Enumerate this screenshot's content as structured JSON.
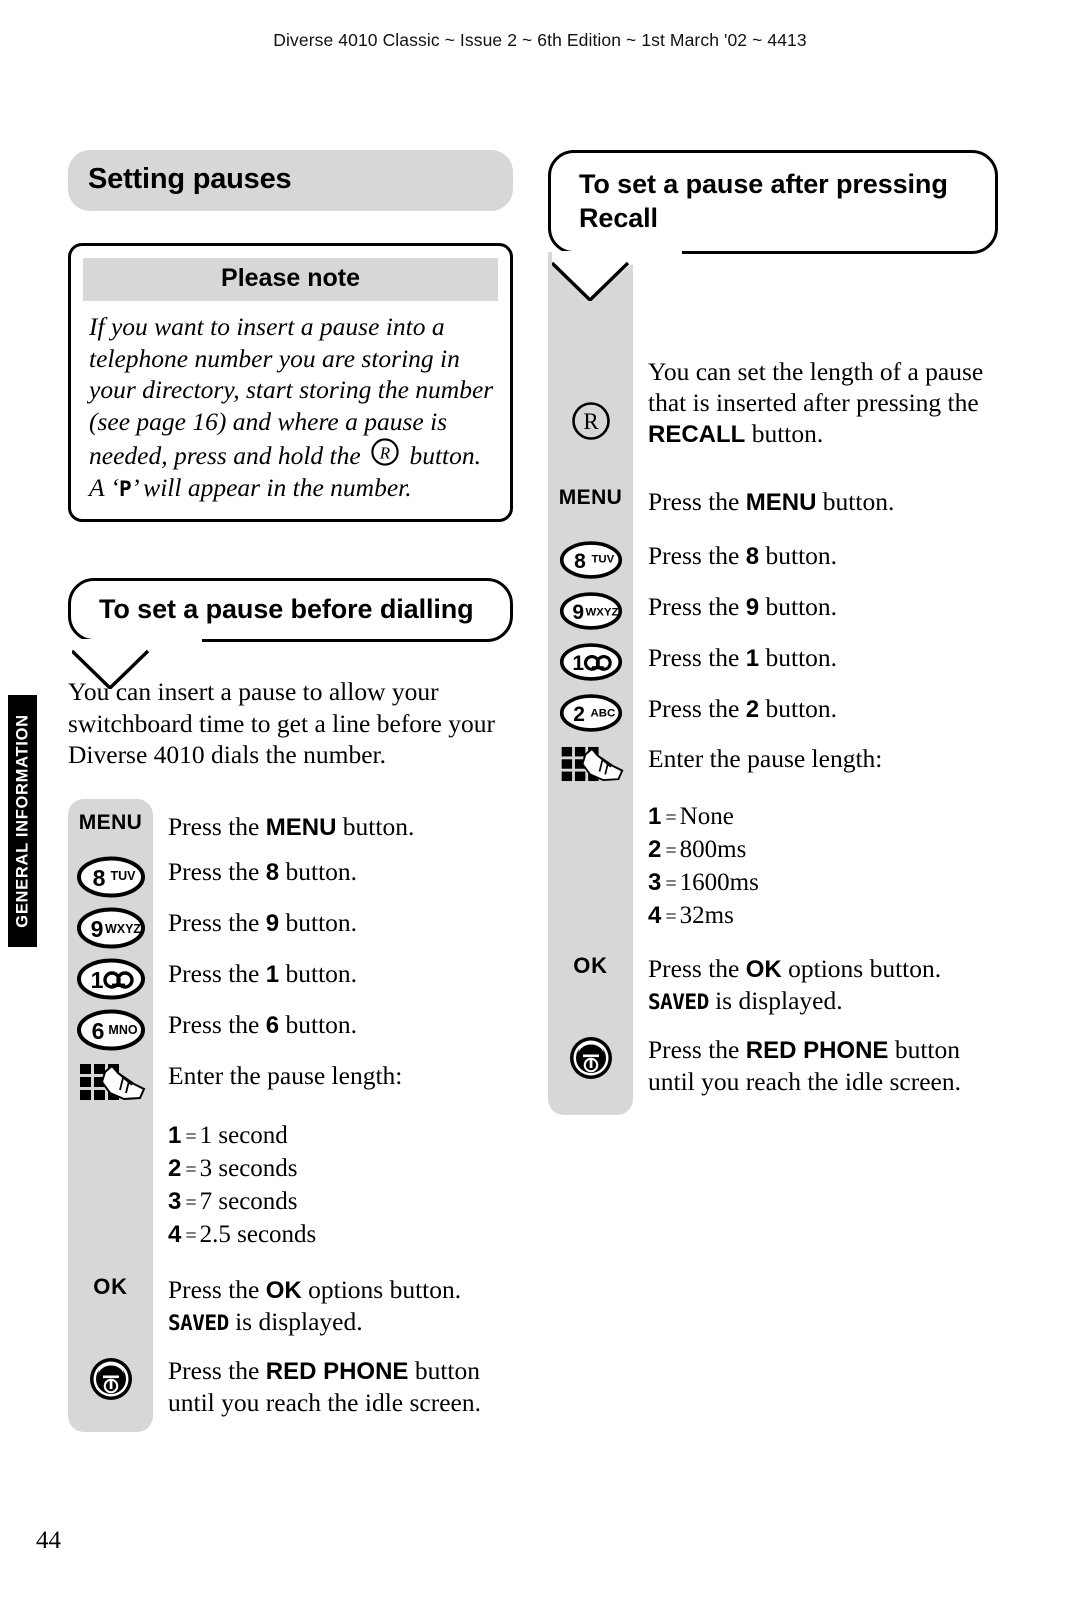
{
  "header": {
    "running_head": "Diverse 4010 Classic ~ Issue 2 ~ 6th Edition ~ 1st March '02 ~ 4413"
  },
  "side_tab": {
    "label": "GENERAL INFORMATION"
  },
  "page_number": "44",
  "left_column": {
    "section_title": "Setting pauses",
    "note": {
      "heading": "Please note",
      "text_part1": "If you want to insert a pause into a telephone number you are storing in your directory, start storing the number (see page 16) and where a pause is needed, press and hold the",
      "text_part2": "button. A ‘",
      "lcd_char": "P",
      "text_part3": "’ will appear in the number."
    },
    "bubble_title": "To set a pause before dialling",
    "intro": "You can insert a pause to allow your switchboard time to get a line before your Diverse 4010 dials the number.",
    "steps": [
      {
        "key": "MENU",
        "key_type": "menu-key",
        "text_before": "Press the ",
        "bold": "MENU",
        "text_after": " button."
      },
      {
        "key": "8",
        "key_letters": "TUV",
        "key_type": "number-key",
        "text_before": "Press the ",
        "bold": "8",
        "text_after": " button."
      },
      {
        "key": "9",
        "key_letters": "WXYZ",
        "key_type": "number-key",
        "text_before": "Press the ",
        "bold": "9",
        "text_after": " button."
      },
      {
        "key": "1",
        "key_letters": "",
        "key_type": "voicemail-key",
        "text_before": "Press the ",
        "bold": "1",
        "text_after": " button."
      },
      {
        "key": "6",
        "key_letters": "MNO",
        "key_type": "number-key",
        "text_before": "Press the ",
        "bold": "6",
        "text_after": " button."
      },
      {
        "key": "keypad",
        "key_type": "keypad-hand",
        "text_before": "Enter the pause length:",
        "bold": "",
        "text_after": ""
      }
    ],
    "options": [
      {
        "num": "1",
        "eq": "=",
        "value": "1 second"
      },
      {
        "num": "2",
        "eq": "=",
        "value": "3 seconds"
      },
      {
        "num": "3",
        "eq": "=",
        "value": "7 seconds"
      },
      {
        "num": "4",
        "eq": "=",
        "value": "2.5 seconds"
      }
    ],
    "ok_step": {
      "key": "OK",
      "text_before": "Press the ",
      "bold": "OK",
      "text_after": " options button.",
      "lcd_word": "SAVED",
      "lcd_after": " is displayed."
    },
    "end_step": {
      "key": "red-phone",
      "text_before": "Press the ",
      "bold": "RED PHONE",
      "text_after": " button until you reach the idle screen."
    }
  },
  "right_column": {
    "bubble_title": "To set a pause after pressing Recall",
    "intro_before": "You can set the length of a pause that is inserted after pressing the ",
    "intro_bold": "RECALL",
    "intro_after": " button.",
    "intro_key": "R",
    "steps": [
      {
        "key": "MENU",
        "key_type": "menu-key",
        "text_before": "Press the ",
        "bold": "MENU",
        "text_after": " button."
      },
      {
        "key": "8",
        "key_letters": "TUV",
        "key_type": "number-key",
        "text_before": "Press the ",
        "bold": "8",
        "text_after": " button."
      },
      {
        "key": "9",
        "key_letters": "WXYZ",
        "key_type": "number-key",
        "text_before": "Press the ",
        "bold": "9",
        "text_after": " button."
      },
      {
        "key": "1",
        "key_letters": "",
        "key_type": "voicemail-key",
        "text_before": "Press the ",
        "bold": "1",
        "text_after": " button."
      },
      {
        "key": "2",
        "key_letters": "ABC",
        "key_type": "number-key",
        "text_before": "Press the ",
        "bold": "2",
        "text_after": " button."
      },
      {
        "key": "keypad",
        "key_type": "keypad-hand",
        "text_before": "Enter the pause length:",
        "bold": "",
        "text_after": ""
      }
    ],
    "options": [
      {
        "num": "1",
        "eq": "=",
        "value": "None"
      },
      {
        "num": "2",
        "eq": "=",
        "value": "800ms"
      },
      {
        "num": "3",
        "eq": "=",
        "value": "1600ms"
      },
      {
        "num": "4",
        "eq": "=",
        "value": "32ms"
      }
    ],
    "ok_step": {
      "key": "OK",
      "text_before": "Press the ",
      "bold": "OK",
      "text_after": " options button.",
      "lcd_word": "SAVED",
      "lcd_after": " is displayed."
    },
    "end_step": {
      "key": "red-phone",
      "text_before": "Press the ",
      "bold": "RED PHONE",
      "text_after": " button until you reach the idle screen."
    }
  },
  "colors": {
    "grey_panel": "#d7d7d7",
    "ink": "#000000",
    "page": "#ffffff"
  }
}
